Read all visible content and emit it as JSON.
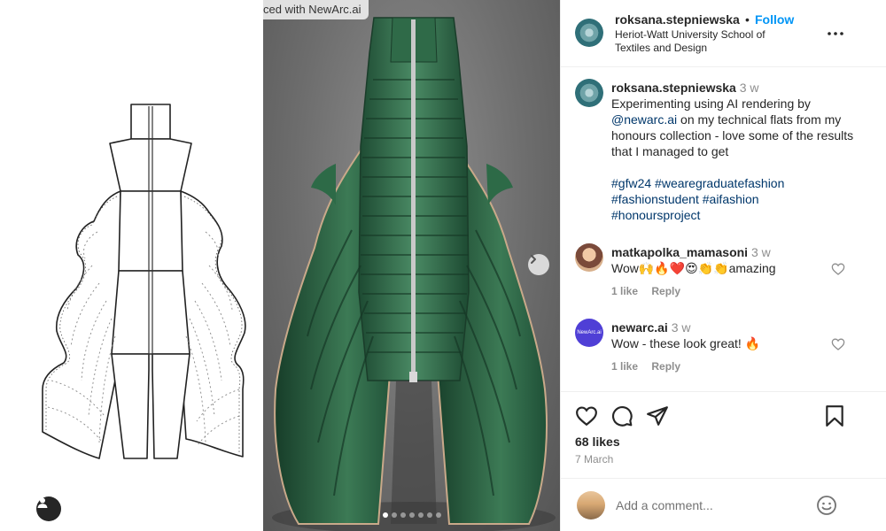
{
  "image_overlay": {
    "credit_text": "ced with NewArc.ai",
    "carousel": {
      "total": 7,
      "active_index": 0
    }
  },
  "post": {
    "author": "roksana.stepniewska",
    "separator": "•",
    "follow_label": "Follow",
    "location": "Heriot-Watt University School of Textiles and Design",
    "caption": {
      "author": "roksana.stepniewska",
      "time": "3 w",
      "text_before": "Experimenting using AI rendering by",
      "mention": "@newarc.ai",
      "text_after": "on my technical flats from my honours collection - love some of the results that I managed to get",
      "hashtags": [
        "#gfw24",
        "#wearegraduatefashion",
        "#fashionstudent",
        "#aifashion",
        "#honoursproject"
      ]
    },
    "comments": [
      {
        "author": "matkapolka_mamasoni",
        "time": "3 w",
        "text": "Wow🙌🔥❤️😍👏👏amazing",
        "likes": "1 like",
        "reply": "Reply"
      },
      {
        "author": "newarc.ai",
        "time": "3 w",
        "text": "Wow - these look great! 🔥",
        "likes": "1 like",
        "reply": "Reply",
        "avatar_text": "NewArc.ai"
      }
    ],
    "likes": "68 likes",
    "date": "7 March",
    "add_comment_placeholder": "Add a comment..."
  },
  "colors": {
    "link_blue": "#0095f6",
    "hashtag": "#00376b",
    "muted": "#8e8e8e",
    "jacket_green": "#2f6a48"
  },
  "icons": [
    "user-tag-icon",
    "chevron-right-icon",
    "more-icon",
    "heart-icon",
    "comment-icon",
    "share-icon",
    "bookmark-icon",
    "emoji-icon"
  ]
}
